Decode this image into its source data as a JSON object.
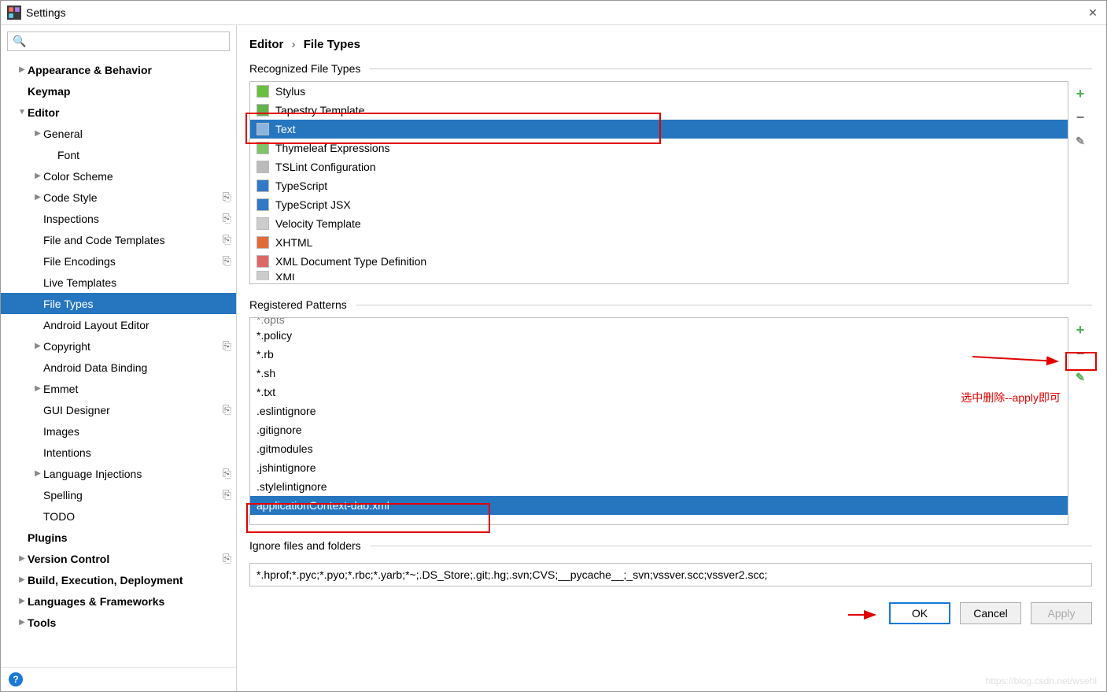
{
  "window": {
    "title": "Settings"
  },
  "search": {
    "placeholder": ""
  },
  "sidebar": {
    "items": [
      {
        "label": "Appearance & Behavior",
        "bold": true,
        "arrow": ">",
        "indent": 1
      },
      {
        "label": "Keymap",
        "bold": true,
        "arrow": "",
        "indent": 1
      },
      {
        "label": "Editor",
        "bold": true,
        "arrow": "v",
        "indent": 1
      },
      {
        "label": "General",
        "bold": false,
        "arrow": ">",
        "indent": 2
      },
      {
        "label": "Font",
        "bold": false,
        "arrow": "",
        "indent": 3
      },
      {
        "label": "Color Scheme",
        "bold": false,
        "arrow": ">",
        "indent": 2
      },
      {
        "label": "Code Style",
        "bold": false,
        "arrow": ">",
        "indent": 2,
        "opt": true
      },
      {
        "label": "Inspections",
        "bold": false,
        "arrow": "",
        "indent": 2,
        "opt": true
      },
      {
        "label": "File and Code Templates",
        "bold": false,
        "arrow": "",
        "indent": 2,
        "opt": true
      },
      {
        "label": "File Encodings",
        "bold": false,
        "arrow": "",
        "indent": 2,
        "opt": true
      },
      {
        "label": "Live Templates",
        "bold": false,
        "arrow": "",
        "indent": 2
      },
      {
        "label": "File Types",
        "bold": false,
        "arrow": "",
        "indent": 2,
        "selected": true
      },
      {
        "label": "Android Layout Editor",
        "bold": false,
        "arrow": "",
        "indent": 2
      },
      {
        "label": "Copyright",
        "bold": false,
        "arrow": ">",
        "indent": 2,
        "opt": true
      },
      {
        "label": "Android Data Binding",
        "bold": false,
        "arrow": "",
        "indent": 2
      },
      {
        "label": "Emmet",
        "bold": false,
        "arrow": ">",
        "indent": 2
      },
      {
        "label": "GUI Designer",
        "bold": false,
        "arrow": "",
        "indent": 2,
        "opt": true
      },
      {
        "label": "Images",
        "bold": false,
        "arrow": "",
        "indent": 2
      },
      {
        "label": "Intentions",
        "bold": false,
        "arrow": "",
        "indent": 2
      },
      {
        "label": "Language Injections",
        "bold": false,
        "arrow": ">",
        "indent": 2,
        "opt": true
      },
      {
        "label": "Spelling",
        "bold": false,
        "arrow": "",
        "indent": 2,
        "opt": true
      },
      {
        "label": "TODO",
        "bold": false,
        "arrow": "",
        "indent": 2
      },
      {
        "label": "Plugins",
        "bold": true,
        "arrow": "",
        "indent": 1
      },
      {
        "label": "Version Control",
        "bold": true,
        "arrow": ">",
        "indent": 1,
        "opt": true
      },
      {
        "label": "Build, Execution, Deployment",
        "bold": true,
        "arrow": ">",
        "indent": 1
      },
      {
        "label": "Languages & Frameworks",
        "bold": true,
        "arrow": ">",
        "indent": 1
      },
      {
        "label": "Tools",
        "bold": true,
        "arrow": ">",
        "indent": 1
      }
    ]
  },
  "breadcrumb": {
    "root": "Editor",
    "leaf": "File Types",
    "sep": "›"
  },
  "sections": {
    "recognized": "Recognized File Types",
    "registered": "Registered Patterns",
    "ignore": "Ignore files and folders"
  },
  "filetypes": [
    {
      "label": "Stylus",
      "ic": "ic-styl"
    },
    {
      "label": "Tapestry Template",
      "ic": "ic-tap"
    },
    {
      "label": "Text",
      "ic": "ic-text",
      "selected": true
    },
    {
      "label": "Thymeleaf Expressions",
      "ic": "ic-thym"
    },
    {
      "label": "TSLint Configuration",
      "ic": "ic-tsl"
    },
    {
      "label": "TypeScript",
      "ic": "ic-ts"
    },
    {
      "label": "TypeScript JSX",
      "ic": "ic-tsx"
    },
    {
      "label": "Velocity Template",
      "ic": "ic-vtl"
    },
    {
      "label": "XHTML",
      "ic": "ic-xhtml"
    },
    {
      "label": "XML Document Type Definition",
      "ic": "ic-dtd"
    },
    {
      "label": "XML",
      "ic": "ic-xml",
      "partial": true
    }
  ],
  "patterns_top_cut": "*.opts",
  "patterns": [
    "*.policy",
    "*.rb",
    "*.sh",
    "*.txt",
    ".eslintignore",
    ".gitignore",
    ".gitmodules",
    ".jshintignore",
    ".stylelintignore"
  ],
  "patterns_selected": "applicationContext-dao.xml",
  "ignore_value": "*.hprof;*.pyc;*.pyo;*.rbc;*.yarb;*~;.DS_Store;.git;.hg;.svn;CVS;__pycache__;_svn;vssver.scc;vssver2.scc;",
  "buttons": {
    "ok": "OK",
    "cancel": "Cancel",
    "apply": "Apply"
  },
  "annotation": {
    "note": "选中删除--apply即可"
  },
  "watermark": "https://blog.csdn.net/wsehl"
}
